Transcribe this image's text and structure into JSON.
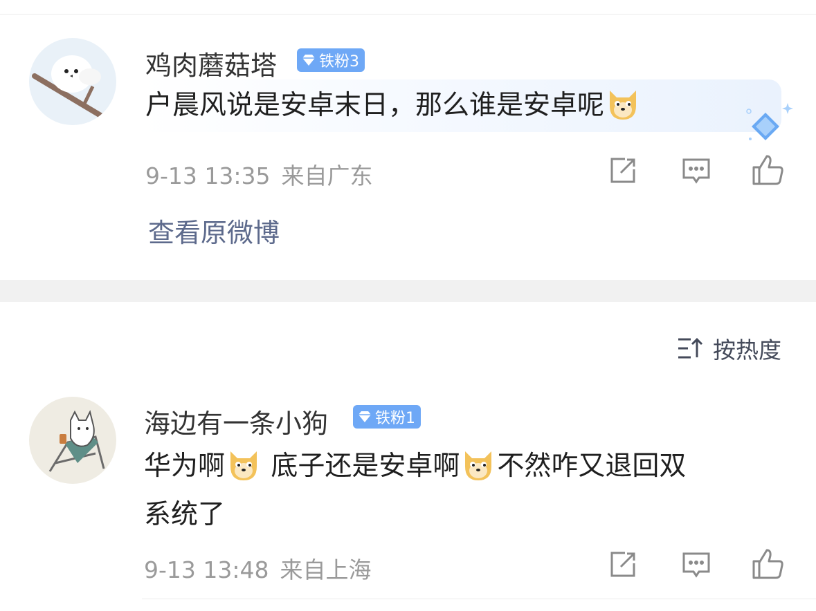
{
  "comments": [
    {
      "username": "鸡肉蘑菇塔",
      "badge": "铁粉3",
      "text": "户晨风说是安卓末日，那么谁是安卓呢",
      "time": "9-13 13:35",
      "location": "来自广东",
      "view_original": "查看原微博"
    },
    {
      "username": "海边有一条小狗",
      "badge": "铁粉1",
      "text_parts": [
        "华为啊",
        " 底子还是安卓啊",
        "不然咋又退回双",
        "系统了"
      ],
      "time": "9-13 13:48",
      "location": "来自上海"
    }
  ],
  "sort_label": "按热度",
  "icons": [
    "repost-icon",
    "comment-icon",
    "like-icon",
    "doge-emoji-icon",
    "diamond-gem-icon",
    "sort-icon"
  ],
  "colors": {
    "badge": "#6ea8f6",
    "link": "#5d6a8c",
    "meta": "#9a9a9a",
    "divider": "#f1f1f1"
  }
}
